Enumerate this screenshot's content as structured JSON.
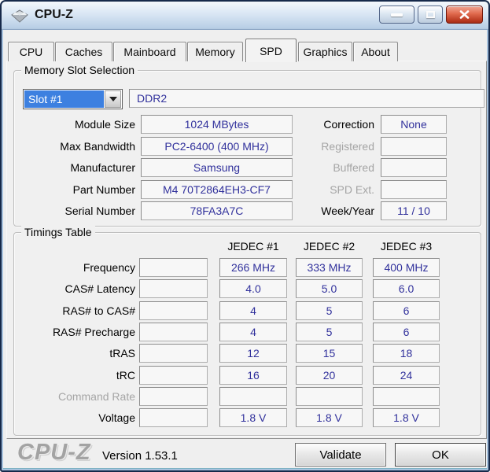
{
  "window": {
    "title": "CPU-Z"
  },
  "icons": {
    "app": "cpuz-diamond-icon",
    "minimize": "minimize-icon",
    "maximize": "maximize-icon",
    "close": "close-x-icon",
    "dropdown": "chevron-down-icon"
  },
  "tabs": {
    "items": [
      "CPU",
      "Caches",
      "Mainboard",
      "Memory",
      "SPD",
      "Graphics",
      "About"
    ],
    "active": "SPD"
  },
  "memory_slot_selection": {
    "legend": "Memory Slot Selection",
    "slot_selector_value": "Slot #1",
    "memory_type": "DDR2",
    "left_fields": [
      {
        "label": "Module Size",
        "value": "1024 MBytes"
      },
      {
        "label": "Max Bandwidth",
        "value": "PC2-6400 (400 MHz)"
      },
      {
        "label": "Manufacturer",
        "value": "Samsung"
      },
      {
        "label": "Part Number",
        "value": "M4 70T2864EH3-CF7"
      },
      {
        "label": "Serial Number",
        "value": "78FA3A7C"
      }
    ],
    "right_fields": [
      {
        "label": "Correction",
        "value": "None",
        "disabled": false
      },
      {
        "label": "Registered",
        "value": "",
        "disabled": true
      },
      {
        "label": "Buffered",
        "value": "",
        "disabled": true
      },
      {
        "label": "SPD Ext.",
        "value": "",
        "disabled": true
      },
      {
        "label": "Week/Year",
        "value": "11 / 10",
        "disabled": false
      }
    ]
  },
  "timings_table": {
    "legend": "Timings Table",
    "columns": [
      "JEDEC #1",
      "JEDEC #2",
      "JEDEC #3"
    ],
    "rows": [
      {
        "label": "Frequency",
        "values": [
          "266 MHz",
          "333 MHz",
          "400 MHz"
        ],
        "disabled": false
      },
      {
        "label": "CAS# Latency",
        "values": [
          "4.0",
          "5.0",
          "6.0"
        ],
        "disabled": false
      },
      {
        "label": "RAS# to CAS#",
        "values": [
          "4",
          "5",
          "6"
        ],
        "disabled": false
      },
      {
        "label": "RAS# Precharge",
        "values": [
          "4",
          "5",
          "6"
        ],
        "disabled": false
      },
      {
        "label": "tRAS",
        "values": [
          "12",
          "15",
          "18"
        ],
        "disabled": false
      },
      {
        "label": "tRC",
        "values": [
          "16",
          "20",
          "24"
        ],
        "disabled": false
      },
      {
        "label": "Command Rate",
        "values": [
          "",
          "",
          ""
        ],
        "disabled": true
      },
      {
        "label": "Voltage",
        "values": [
          "1.8 V",
          "1.8 V",
          "1.8 V"
        ],
        "disabled": false
      }
    ]
  },
  "footer": {
    "logo": "CPU-Z",
    "version": "Version 1.53.1",
    "validate_label": "Validate",
    "ok_label": "OK"
  },
  "colors": {
    "value_text": "#31319C",
    "selection_blue": "#3D80E0",
    "close_red": "#B5351D",
    "titlebar_top": "#F4F8FC",
    "titlebar_bottom": "#AFC6DE",
    "dialog_bg": "#F0F0F0"
  }
}
